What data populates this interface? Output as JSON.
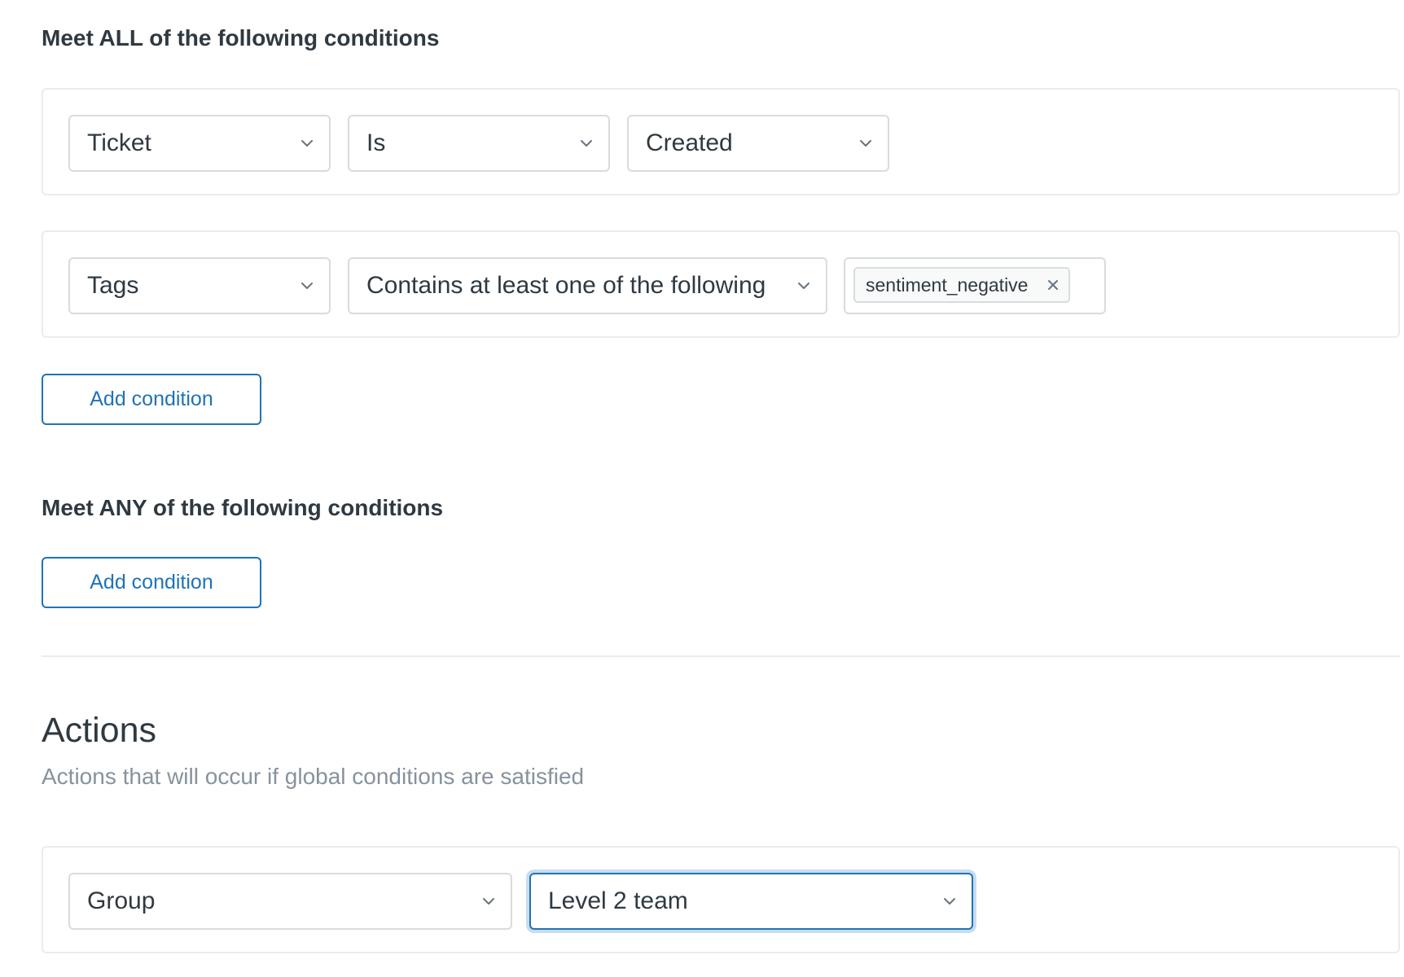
{
  "all_conditions": {
    "heading": "Meet ALL of the following conditions",
    "rows": [
      {
        "field": "Ticket",
        "operator": "Is",
        "value": "Created"
      },
      {
        "field": "Tags",
        "operator": "Contains at least one of the following",
        "tag": "sentiment_negative"
      }
    ],
    "add_button": "Add condition"
  },
  "any_conditions": {
    "heading": "Meet ANY of the following conditions",
    "add_button": "Add condition"
  },
  "actions": {
    "title": "Actions",
    "subtitle": "Actions that will occur if global conditions are satisfied",
    "rows": [
      {
        "field": "Group",
        "value": "Level 2 team"
      }
    ]
  },
  "colors": {
    "accent": "#1f73b7",
    "text": "#2f3941",
    "muted_text": "#87929d",
    "border": "#d8dcde",
    "row_border": "#e9ebed",
    "focus_ring": "#c8dcf0"
  },
  "icons": {
    "dropdown": "chevron-down-icon",
    "remove_tag": "close-icon"
  }
}
